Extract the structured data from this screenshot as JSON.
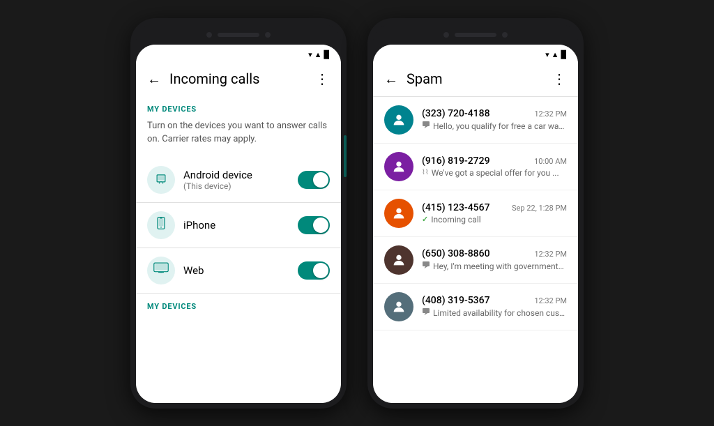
{
  "phone1": {
    "header": {
      "back_label": "←",
      "title": "Incoming calls",
      "more_label": "⋮"
    },
    "status": {
      "icons": "▾▲▉"
    },
    "section1": {
      "label": "MY DEVICES",
      "description": "Turn on the devices you want to answer calls on. Carrier rates may apply."
    },
    "devices": [
      {
        "icon": "📱",
        "name": "Android device",
        "subtitle": "(This device)",
        "toggled": true
      },
      {
        "icon": "📱",
        "name": "iPhone",
        "subtitle": "",
        "toggled": true
      },
      {
        "icon": "🖥",
        "name": "Web",
        "subtitle": "",
        "toggled": true
      }
    ],
    "section2": {
      "label": "MY DEVICES"
    }
  },
  "phone2": {
    "header": {
      "back_label": "←",
      "title": "Spam",
      "more_label": "⋮"
    },
    "spam_items": [
      {
        "avatar_color": "#00838f",
        "number": "(323) 720-4188",
        "time": "12:32 PM",
        "preview_icon": "💬",
        "preview": "Hello, you qualify for free a car wash"
      },
      {
        "avatar_color": "#7b1fa2",
        "number": "(916) 819-2729",
        "time": "10:00 AM",
        "preview_icon": "∞",
        "preview": "We've got a special offer for you ..."
      },
      {
        "avatar_color": "#e65100",
        "number": "(415) 123-4567",
        "time": "Sep 22, 1:28 PM",
        "preview_icon": "✓",
        "preview": "Incoming call"
      },
      {
        "avatar_color": "#4e342e",
        "number": "(650) 308-8860",
        "time": "12:32 PM",
        "preview_icon": "💬",
        "preview": "Hey, I'm meeting with governmental ..."
      },
      {
        "avatar_color": "#546e7a",
        "number": "(408) 319-5367",
        "time": "12:32 PM",
        "preview_icon": "💬",
        "preview": "Limited availability for chosen cust..."
      }
    ]
  }
}
